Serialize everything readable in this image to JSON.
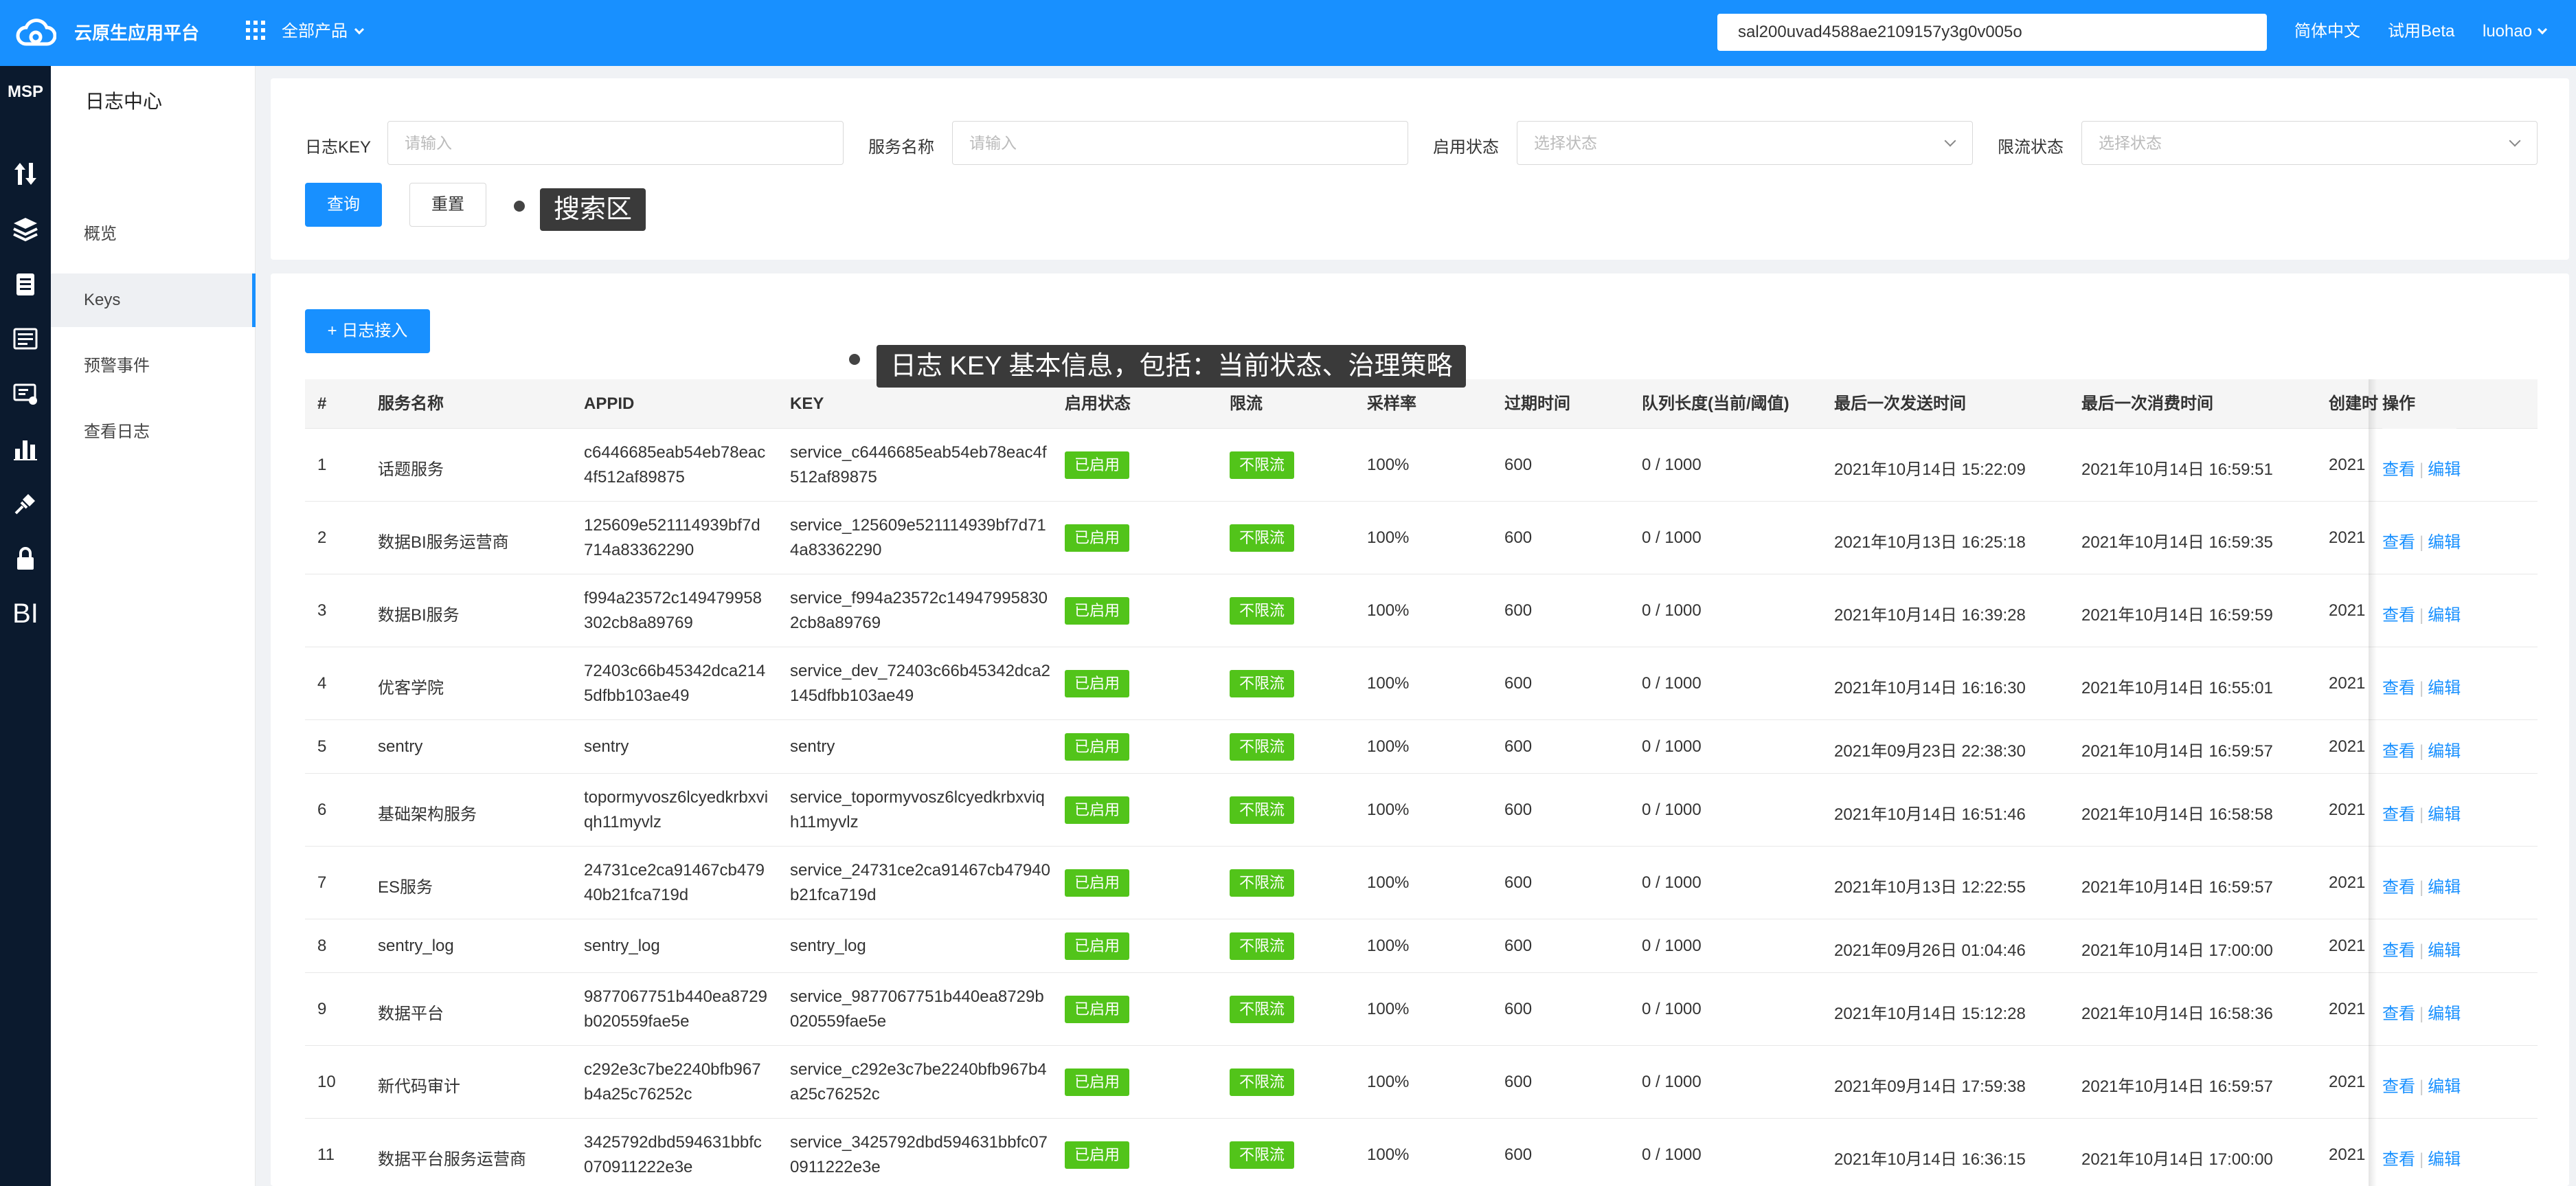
{
  "header": {
    "brand": "云原生应用平台",
    "all_products": "全部产品",
    "search_value": "sal200uvad4588ae2109157y3g0v005o",
    "language": "简体中文",
    "beta": "试用Beta",
    "user": "luohao"
  },
  "rail": {
    "label": "MSP",
    "bi_label": "BI"
  },
  "sidebar": {
    "title": "日志中心",
    "items": [
      {
        "label": "概览"
      },
      {
        "label": "Keys"
      },
      {
        "label": "预警事件"
      },
      {
        "label": "查看日志"
      }
    ]
  },
  "search": {
    "log_key_label": "日志KEY",
    "log_key_placeholder": "请输入",
    "service_label": "服务名称",
    "service_placeholder": "请输入",
    "enable_label": "启用状态",
    "enable_placeholder": "选择状态",
    "limit_label": "限流状态",
    "limit_placeholder": "选择状态",
    "query_button": "查询",
    "reset_button": "重置",
    "tooltip": "搜索区"
  },
  "table": {
    "add_button": "+ 日志接入",
    "tooltip": "日志 KEY 基本信息，包括：当前状态、治理策略",
    "columns": [
      "#",
      "服务名称",
      "APPID",
      "KEY",
      "启用状态",
      "限流",
      "采样率",
      "过期时间",
      "队列长度(当前/阈值)",
      "最后一次发送时间",
      "最后一次消费时间",
      "创建时",
      "操作"
    ],
    "view_label": "查看",
    "edit_label": "编辑",
    "rows": [
      {
        "no": "1",
        "service": "话题服务",
        "appid": "c6446685eab54eb78eac4f512af89875",
        "key": "service_c6446685eab54eb78eac4f512af89875",
        "status": "已启用",
        "limit": "不限流",
        "rate": "100%",
        "expire": "600",
        "queue": "0 / 1000",
        "last_send": "2021年10月14日 15:22:09",
        "last_consume": "2021年10月14日 16:59:51",
        "created": "2021"
      },
      {
        "no": "2",
        "service": "数据BI服务运营商",
        "appid": "125609e521114939bf7d714a83362290",
        "key": "service_125609e521114939bf7d714a83362290",
        "status": "已启用",
        "limit": "不限流",
        "rate": "100%",
        "expire": "600",
        "queue": "0 / 1000",
        "last_send": "2021年10月13日 16:25:18",
        "last_consume": "2021年10月14日 16:59:35",
        "created": "2021"
      },
      {
        "no": "3",
        "service": "数据BI服务",
        "appid": "f994a23572c149479958302cb8a89769",
        "key": "service_f994a23572c149479958302cb8a89769",
        "status": "已启用",
        "limit": "不限流",
        "rate": "100%",
        "expire": "600",
        "queue": "0 / 1000",
        "last_send": "2021年10月14日 16:39:28",
        "last_consume": "2021年10月14日 16:59:59",
        "created": "2021"
      },
      {
        "no": "4",
        "service": "优客学院",
        "appid": "72403c66b45342dca2145dfbb103ae49",
        "key": "service_dev_72403c66b45342dca2145dfbb103ae49",
        "status": "已启用",
        "limit": "不限流",
        "rate": "100%",
        "expire": "600",
        "queue": "0 / 1000",
        "last_send": "2021年10月14日 16:16:30",
        "last_consume": "2021年10月14日 16:55:01",
        "created": "2021"
      },
      {
        "no": "5",
        "service": "sentry",
        "appid": "sentry",
        "key": "sentry",
        "status": "已启用",
        "limit": "不限流",
        "rate": "100%",
        "expire": "600",
        "queue": "0 / 1000",
        "last_send": "2021年09月23日 22:38:30",
        "last_consume": "2021年10月14日 16:59:57",
        "created": "2021"
      },
      {
        "no": "6",
        "service": "基础架构服务",
        "appid": "topormyvosz6lcyedkrbxviqh11myvlz",
        "key": "service_topormyvosz6lcyedkrbxviqh11myvlz",
        "status": "已启用",
        "limit": "不限流",
        "rate": "100%",
        "expire": "600",
        "queue": "0 / 1000",
        "last_send": "2021年10月14日 16:51:46",
        "last_consume": "2021年10月14日 16:58:58",
        "created": "2021"
      },
      {
        "no": "7",
        "service": "ES服务",
        "appid": "24731ce2ca91467cb47940b21fca719d",
        "key": "service_24731ce2ca91467cb47940b21fca719d",
        "status": "已启用",
        "limit": "不限流",
        "rate": "100%",
        "expire": "600",
        "queue": "0 / 1000",
        "last_send": "2021年10月13日 12:22:55",
        "last_consume": "2021年10月14日 16:59:57",
        "created": "2021"
      },
      {
        "no": "8",
        "service": "sentry_log",
        "appid": "sentry_log",
        "key": "sentry_log",
        "status": "已启用",
        "limit": "不限流",
        "rate": "100%",
        "expire": "600",
        "queue": "0 / 1000",
        "last_send": "2021年09月26日 01:04:46",
        "last_consume": "2021年10月14日 17:00:00",
        "created": "2021"
      },
      {
        "no": "9",
        "service": "数据平台",
        "appid": "9877067751b440ea8729b020559fae5e",
        "key": "service_9877067751b440ea8729b020559fae5e",
        "status": "已启用",
        "limit": "不限流",
        "rate": "100%",
        "expire": "600",
        "queue": "0 / 1000",
        "last_send": "2021年10月14日 15:12:28",
        "last_consume": "2021年10月14日 16:58:36",
        "created": "2021"
      },
      {
        "no": "10",
        "service": "新代码审计",
        "appid": "c292e3c7be2240bfb967b4a25c76252c",
        "key": "service_c292e3c7be2240bfb967b4a25c76252c",
        "status": "已启用",
        "limit": "不限流",
        "rate": "100%",
        "expire": "600",
        "queue": "0 / 1000",
        "last_send": "2021年09月14日 17:59:38",
        "last_consume": "2021年10月14日 16:59:57",
        "created": "2021"
      },
      {
        "no": "11",
        "service": "数据平台服务运营商",
        "appid": "3425792dbd594631bbfc070911222e3e",
        "key": "service_3425792dbd594631bbfc070911222e3e",
        "status": "已启用",
        "limit": "不限流",
        "rate": "100%",
        "expire": "600",
        "queue": "0 / 1000",
        "last_send": "2021年10月14日 16:36:15",
        "last_consume": "2021年10月14日 17:00:00",
        "created": "2021"
      }
    ]
  }
}
